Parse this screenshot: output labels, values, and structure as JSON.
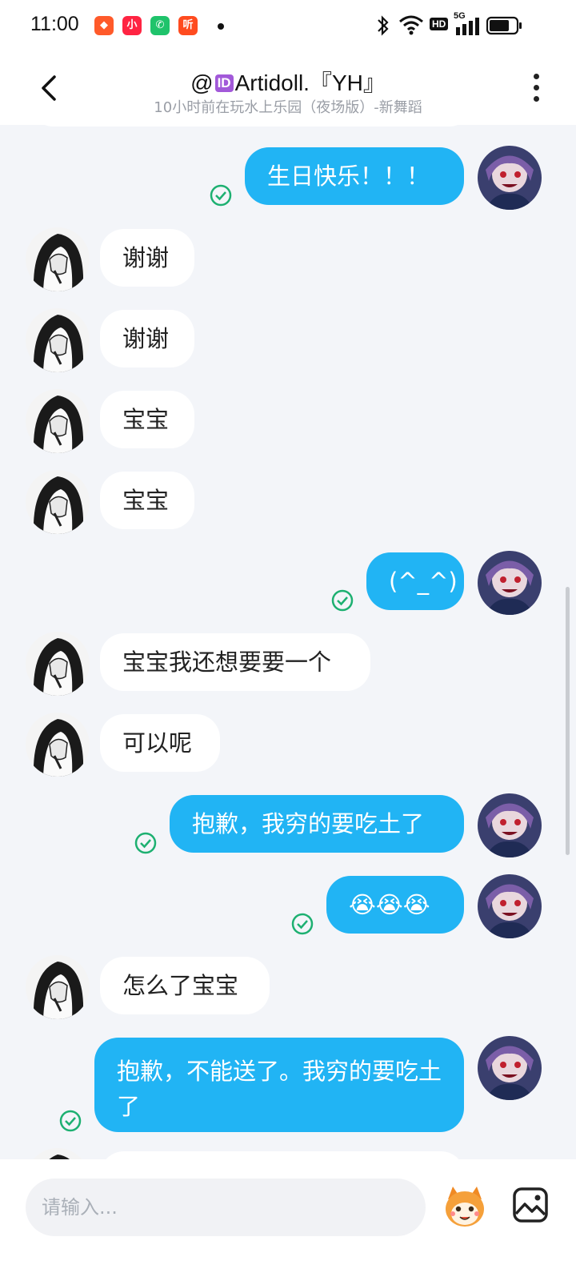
{
  "status_bar": {
    "time": "11:00",
    "app_icons": [
      {
        "name": "game-icon",
        "text": "◆",
        "color": "#ff5a2a"
      },
      {
        "name": "xiaohongshu-icon",
        "text": "小",
        "color": "#ff2442"
      },
      {
        "name": "phone-call-icon",
        "text": "✆",
        "color": "#1fc36b"
      },
      {
        "name": "listen-icon",
        "text": "听",
        "color": "#ff4b1f"
      }
    ],
    "right_icons": [
      "bluetooth-icon",
      "wifi-icon",
      "hd-icon",
      "signal-5g-icon",
      "battery-icon"
    ],
    "hd_label": "HD",
    "network_label": "5G"
  },
  "header": {
    "title_prefix": "@",
    "title_id_badge": "ID",
    "title_name": "Artidoll.『YH』",
    "subtitle": "10小时前在玩水上乐园（夜场版）-新舞蹈"
  },
  "messages": [
    {
      "dir": "out",
      "text": "生日快乐！！！",
      "status": "delivered"
    },
    {
      "dir": "in",
      "text": "谢谢"
    },
    {
      "dir": "in",
      "text": "谢谢"
    },
    {
      "dir": "in",
      "text": "宝宝"
    },
    {
      "dir": "in",
      "text": "宝宝"
    },
    {
      "dir": "out",
      "text": "(^_^)",
      "status": "delivered"
    },
    {
      "dir": "in",
      "text": "宝宝我还想要要一个"
    },
    {
      "dir": "in",
      "text": "可以呢"
    },
    {
      "dir": "out",
      "text": "抱歉，我穷的要吃土了",
      "status": "delivered"
    },
    {
      "dir": "out",
      "text": "😭😭😭",
      "status": "delivered"
    },
    {
      "dir": "in",
      "text": "怎么了宝宝"
    },
    {
      "dir": "out",
      "text": "抱歉，不能送了。我穷的要吃土了",
      "status": "delivered"
    }
  ],
  "input": {
    "placeholder": "请输入..."
  },
  "colors": {
    "outgoing_bubble": "#21b4f4",
    "incoming_bubble": "#ffffff",
    "delivered_check": "#1db071",
    "background": "#f3f5f9"
  }
}
